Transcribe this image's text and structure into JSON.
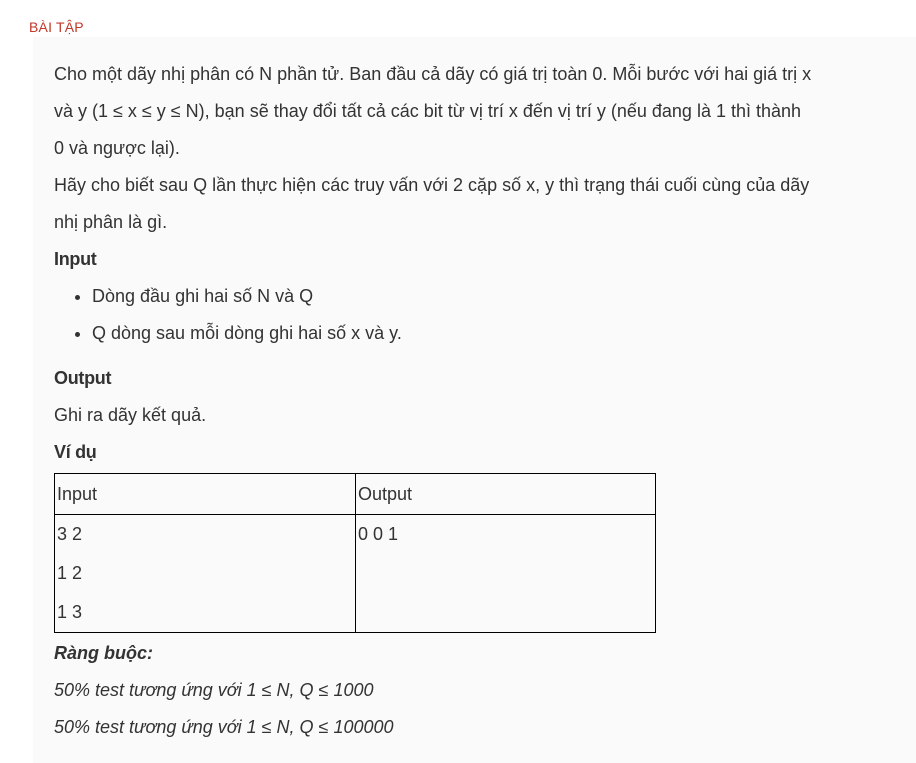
{
  "section_label": "BÀI TẬP",
  "intro": {
    "line1": "Cho một dãy nhị phân có N phần tử. Ban đầu cả dãy có giá trị toàn 0. Mỗi bước với hai giá trị x",
    "line2": "và y (1 ≤ x ≤ y ≤ N), bạn sẽ thay đổi tất cả các bit từ vị trí x đến vị trí y (nếu đang là 1 thì thành",
    "line3": "0 và ngược lại).",
    "line4": "Hãy cho biết sau Q lần thực hiện các truy vấn với 2 cặp số x, y thì trạng thái cuối cùng của dãy",
    "line5": "nhị phân là gì."
  },
  "input_section": {
    "heading": "Input",
    "items": [
      "Dòng đầu ghi hai số N và Q",
      "Q dòng sau mỗi dòng ghi hai số x và y."
    ]
  },
  "output_section": {
    "heading": "Output",
    "text": "Ghi ra dãy kết quả."
  },
  "example": {
    "heading": "Ví dụ",
    "headers": [
      "Input",
      "Output"
    ],
    "input_lines": [
      "3 2",
      "1 2",
      "1 3"
    ],
    "output_lines": [
      "0 0 1"
    ]
  },
  "constraints": {
    "heading": "Ràng buộc:",
    "lines": [
      "50% test tương ứng với 1 ≤ N, Q ≤ 1000",
      "50% test tương ứng với  1 ≤ N, Q ≤ 100000"
    ]
  }
}
